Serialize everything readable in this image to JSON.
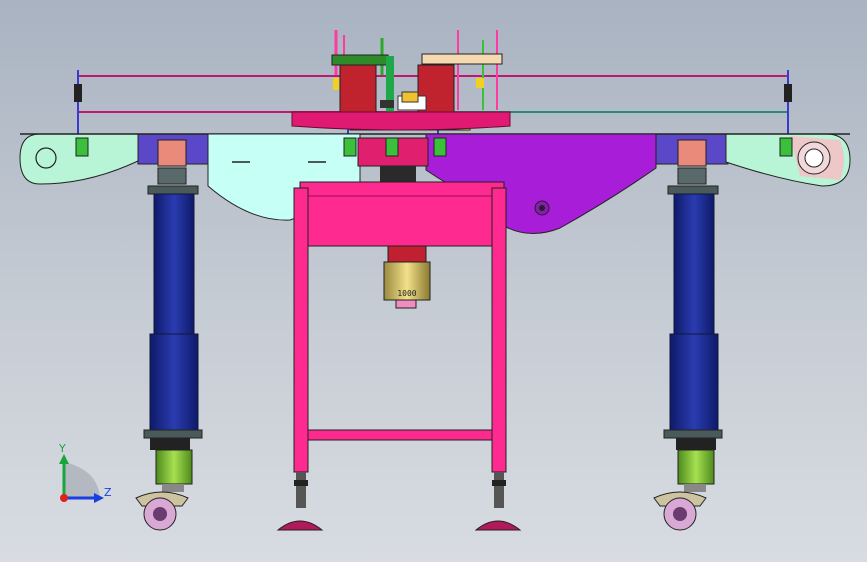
{
  "view": {
    "background_top": "#a9b3c1",
    "background_bottom": "#d8dce2"
  },
  "colors": {
    "frame_magenta": "#ff2a8f",
    "turntable_pink": "#e01a72",
    "guard_purple": "#a81ed8",
    "guard_cyan": "#c6fff6",
    "belt_mint": "#b8f5d6",
    "belt_blue": "#4a3fc8",
    "column_navy": "#1b2a8c",
    "motor_green": "#8ac63a",
    "caster_pink": "#d9a8d4",
    "bracket_salmon": "#e98a7a",
    "rail_magenta": "#c01870",
    "rail_green": "#2a8a2a",
    "gearmotor_gold": "#e0c25a",
    "outline": "#2a2a2a"
  },
  "motor_label": "1000",
  "triad": {
    "y_label": "Y",
    "z_label": "Z",
    "y_color": "#18a63a",
    "z_color": "#1a3fe0",
    "x_color": "#e0201a"
  }
}
